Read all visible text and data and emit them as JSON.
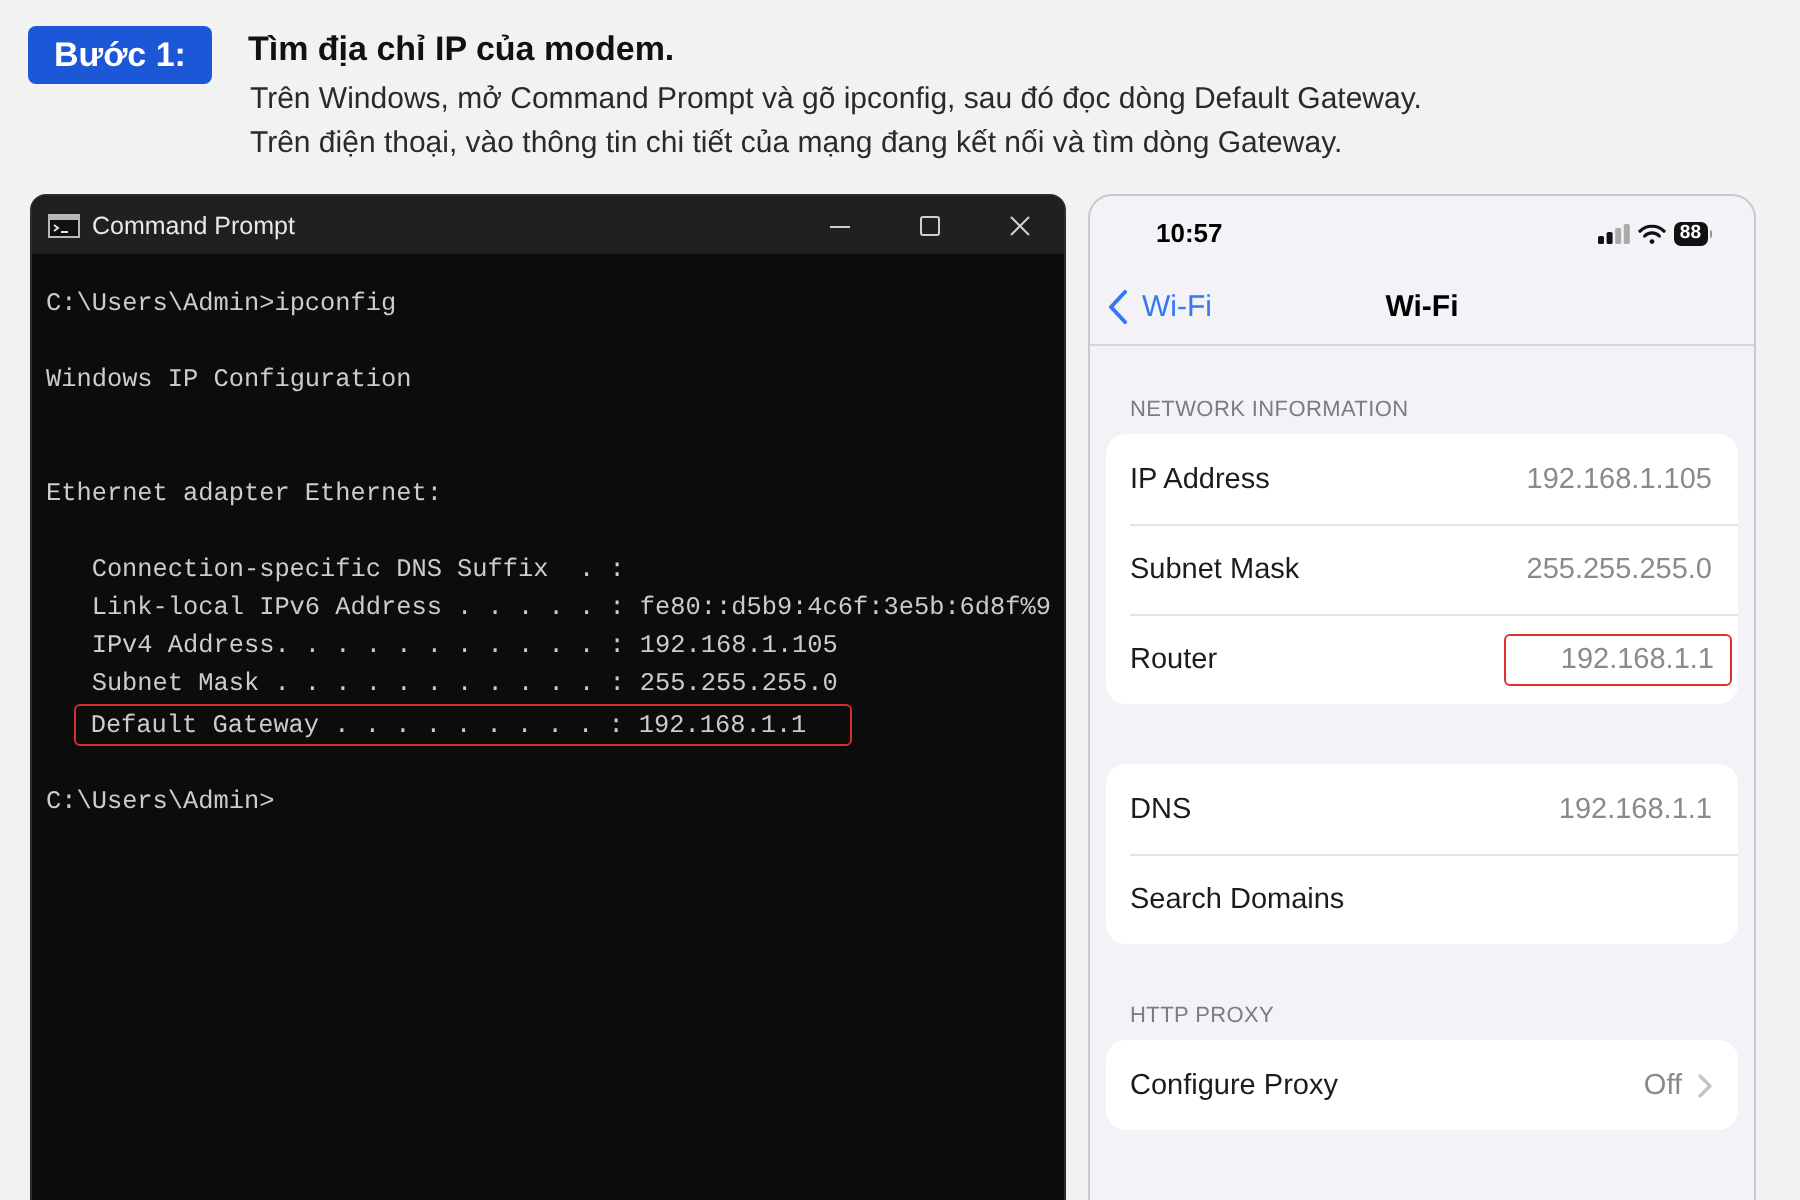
{
  "step": {
    "badge": "Bước 1:",
    "title": "Tìm địa chỉ IP của modem.",
    "lines": [
      "Trên Windows, mở Command Prompt và gõ ipconfig, sau đó đọc dòng Default Gateway.",
      "Trên điện thoại, vào thông tin chi tiết của mạng đang kết nối và tìm dòng Gateway."
    ]
  },
  "terminal": {
    "title": "Command Prompt",
    "lines": [
      {
        "kind": "prompt",
        "text": "C:\\Users\\Admin>ipconfig",
        "highlighted": false
      },
      {
        "kind": "title",
        "text": "Windows IP Configuration",
        "highlighted": false
      },
      {
        "kind": "adapter",
        "text": "Ethernet adapter Ethernet:",
        "highlighted": false
      },
      {
        "kind": "entry",
        "text": "Connection-specific DNS Suffix  . :",
        "highlighted": false
      },
      {
        "kind": "entry",
        "text": "Link-local IPv6 Address . . . . . : fe80::d5b9:4c6f:3e5b:6d8f%9",
        "highlighted": false
      },
      {
        "kind": "entry",
        "text": "IPv4 Address. . . . . . . . . . . : 192.168.1.105",
        "highlighted": false
      },
      {
        "kind": "entry",
        "text": "Subnet Mask . . . . . . . . . . . : 255.255.255.0",
        "highlighted": false
      },
      {
        "kind": "entry",
        "text": "Default Gateway . . . . . . . . . : 192.168.1.1",
        "highlighted": true
      },
      {
        "kind": "prompt",
        "text": "C:\\Users\\Admin>",
        "highlighted": false
      }
    ]
  },
  "phone": {
    "status_bar": {
      "time": "10:57",
      "battery": "88"
    },
    "nav": {
      "back": "Wi-Fi",
      "title": "Wi-Fi"
    },
    "sections": [
      {
        "header": "NETWORK INFORMATION",
        "rows": [
          {
            "label": "IP Address",
            "value": "192.168.1.105",
            "highlighted": false,
            "disclosure": false
          },
          {
            "label": "Subnet Mask",
            "value": "255.255.255.0",
            "highlighted": false,
            "disclosure": false
          },
          {
            "label": "Router",
            "value": "192.168.1.1",
            "highlighted": true,
            "disclosure": false
          }
        ]
      },
      {
        "rows": [
          {
            "label": "DNS",
            "value": "192.168.1.1",
            "highlighted": false,
            "disclosure": false
          },
          {
            "label": "Search Domains",
            "highlighted": false,
            "disclosure": false
          }
        ]
      },
      {
        "header": "HTTP PROXY",
        "rows": [
          {
            "label": "Configure Proxy",
            "value": "Off",
            "highlighted": false,
            "disclosure": true
          }
        ]
      }
    ]
  }
}
